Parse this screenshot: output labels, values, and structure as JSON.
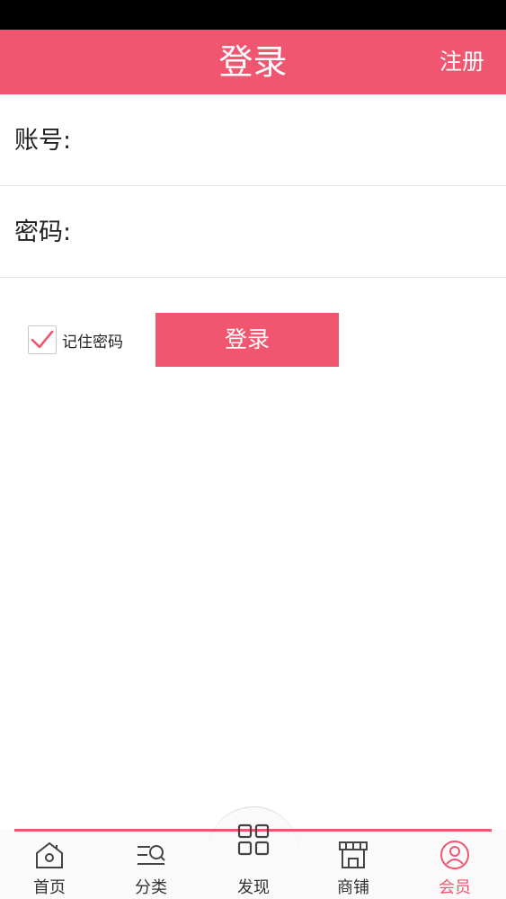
{
  "header": {
    "title": "登录",
    "register_label": "注册"
  },
  "form": {
    "account_label": "账号:",
    "account_value": "",
    "password_label": "密码:",
    "password_value": ""
  },
  "remember": {
    "label": "记住密码",
    "checked": true
  },
  "login_button_label": "登录",
  "tabbar": {
    "items": [
      {
        "label": "首页",
        "icon": "home-icon"
      },
      {
        "label": "分类",
        "icon": "category-icon"
      },
      {
        "label": "发现",
        "icon": "grid-icon"
      },
      {
        "label": "商铺",
        "icon": "store-icon"
      },
      {
        "label": "会员",
        "icon": "member-icon",
        "active": true
      }
    ]
  },
  "colors": {
    "accent": "#f0566f"
  }
}
